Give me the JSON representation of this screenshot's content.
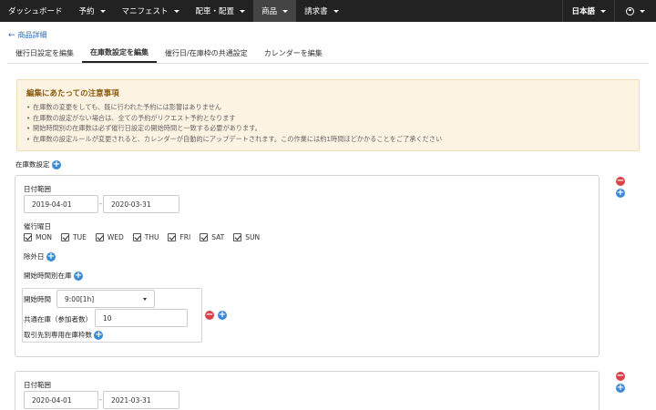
{
  "nav": {
    "items": [
      {
        "label": "ダッシュボード",
        "caret": false
      },
      {
        "label": "予約",
        "caret": true
      },
      {
        "label": "マニフェスト",
        "caret": true
      },
      {
        "label": "配車・配置",
        "caret": true
      },
      {
        "label": "商品",
        "caret": true,
        "active": true
      },
      {
        "label": "請求書",
        "caret": true
      }
    ],
    "language": "日本語"
  },
  "breadcrumb": {
    "back_label": "商品詳細"
  },
  "tabs": [
    {
      "label": "催行日設定を編集"
    },
    {
      "label": "在庫数設定を編集",
      "active": true
    },
    {
      "label": "催行日/在庫枠の共通設定"
    },
    {
      "label": "カレンダーを編集"
    }
  ],
  "notice": {
    "title": "編集にあたっての注意事項",
    "items": [
      "在庫数の変更をしても、既に行われた予約には影響はありません",
      "在庫数の設定がない場合は、全ての予約がリクエスト予約となります",
      "開始時間別の在庫数は必ず催行日設定の開始時間と一致する必要があります。",
      "在庫数の設定ルールが変更されると、カレンダーが自動的にアップデートされます。この作業には約1時間ほどかかることをご了承ください"
    ]
  },
  "inventory": {
    "section_label": "在庫数設定",
    "blocks": [
      {
        "date_range_label": "日付範囲",
        "start_date": "2019-04-01",
        "end_date": "2020-03-31",
        "weekdays_label": "催行曜日",
        "weekdays": [
          "MON",
          "TUE",
          "WED",
          "THU",
          "FRI",
          "SAT",
          "SUN"
        ],
        "exclusion_label": "除外日",
        "time_inventory_label": "開始時間別在庫",
        "start_time_label": "開始時間",
        "start_time_value": "9:00[1h]",
        "shared_inventory_label": "共通在庫（参加者数）",
        "shared_inventory_value": "10",
        "partner_inventory_label": "取引先別専用在庫枠数"
      },
      {
        "date_range_label": "日付範囲",
        "start_date": "2020-04-01",
        "end_date": "2021-03-31"
      }
    ]
  },
  "colors": {
    "nav_bg": "#222222",
    "link": "#2f6db5",
    "add": "#3a8ad6",
    "remove": "#d9434a",
    "notice_bg": "#fdf3e3",
    "notice_title": "#8a5a10"
  },
  "icons": {
    "add": "plus-circle-icon",
    "remove": "minus-circle-icon",
    "back": "arrow-left-icon",
    "user": "user-circle-icon",
    "caret": "caret-down-icon"
  }
}
